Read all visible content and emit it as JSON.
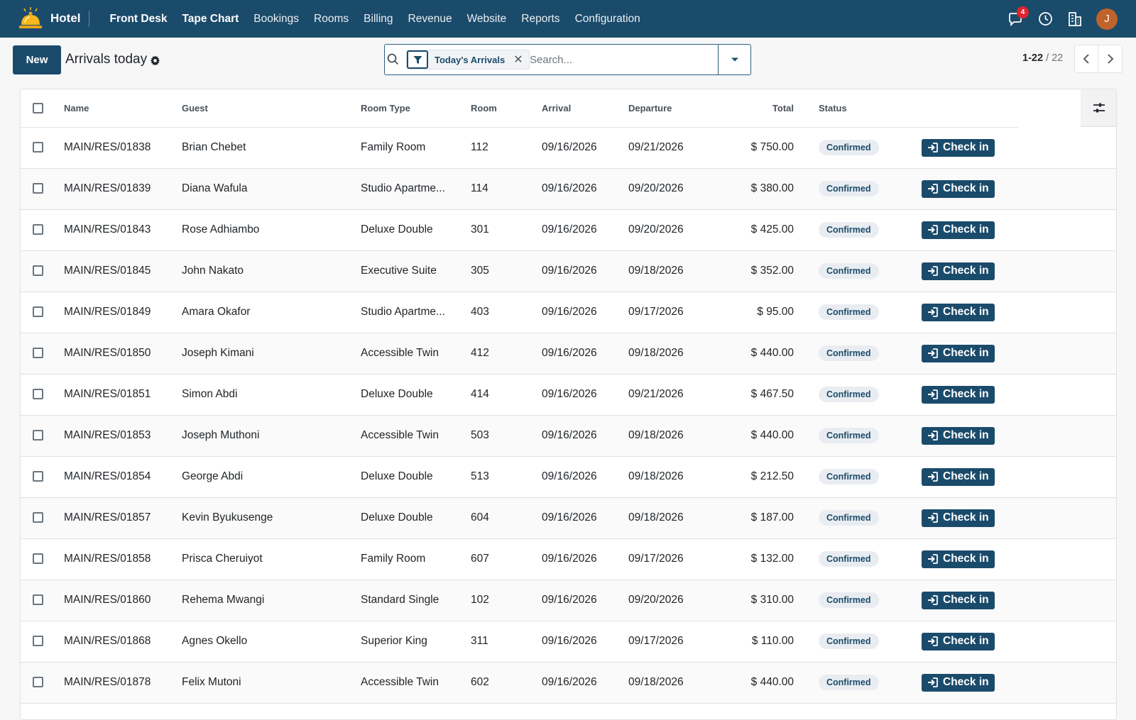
{
  "app": {
    "name": "Hotel"
  },
  "nav": {
    "items": [
      {
        "label": "Front Desk",
        "active": true
      },
      {
        "label": "Tape Chart",
        "active": true
      },
      {
        "label": "Bookings",
        "active": false
      },
      {
        "label": "Rooms",
        "active": false
      },
      {
        "label": "Billing",
        "active": false
      },
      {
        "label": "Revenue",
        "active": false
      },
      {
        "label": "Website",
        "active": false
      },
      {
        "label": "Reports",
        "active": false
      },
      {
        "label": "Configuration",
        "active": false
      }
    ],
    "messages_badge": "4",
    "avatar_initial": "J"
  },
  "control": {
    "new_label": "New",
    "title": "Arrivals today",
    "facet_label": "Today's Arrivals",
    "search_placeholder": "Search...",
    "pager_value": "1-22",
    "pager_limit": "/ 22"
  },
  "table": {
    "columns": [
      "Name",
      "Guest",
      "Room Type",
      "Room",
      "Arrival",
      "Departure",
      "Total",
      "Status"
    ],
    "checkin_label": "Check in",
    "rows": [
      {
        "name": "MAIN/RES/01838",
        "guest": "Brian Chebet",
        "room_type": "Family Room",
        "room": "112",
        "arrival": "09/16/2026",
        "departure": "09/21/2026",
        "total": "$ 750.00",
        "status": "Confirmed"
      },
      {
        "name": "MAIN/RES/01839",
        "guest": "Diana Wafula",
        "room_type": "Studio Apartme...",
        "room": "114",
        "arrival": "09/16/2026",
        "departure": "09/20/2026",
        "total": "$ 380.00",
        "status": "Confirmed"
      },
      {
        "name": "MAIN/RES/01843",
        "guest": "Rose Adhiambo",
        "room_type": "Deluxe Double",
        "room": "301",
        "arrival": "09/16/2026",
        "departure": "09/20/2026",
        "total": "$ 425.00",
        "status": "Confirmed"
      },
      {
        "name": "MAIN/RES/01845",
        "guest": "John Nakato",
        "room_type": "Executive Suite",
        "room": "305",
        "arrival": "09/16/2026",
        "departure": "09/18/2026",
        "total": "$ 352.00",
        "status": "Confirmed"
      },
      {
        "name": "MAIN/RES/01849",
        "guest": "Amara Okafor",
        "room_type": "Studio Apartme...",
        "room": "403",
        "arrival": "09/16/2026",
        "departure": "09/17/2026",
        "total": "$ 95.00",
        "status": "Confirmed"
      },
      {
        "name": "MAIN/RES/01850",
        "guest": "Joseph Kimani",
        "room_type": "Accessible Twin",
        "room": "412",
        "arrival": "09/16/2026",
        "departure": "09/18/2026",
        "total": "$ 440.00",
        "status": "Confirmed"
      },
      {
        "name": "MAIN/RES/01851",
        "guest": "Simon Abdi",
        "room_type": "Deluxe Double",
        "room": "414",
        "arrival": "09/16/2026",
        "departure": "09/21/2026",
        "total": "$ 467.50",
        "status": "Confirmed"
      },
      {
        "name": "MAIN/RES/01853",
        "guest": "Joseph Muthoni",
        "room_type": "Accessible Twin",
        "room": "503",
        "arrival": "09/16/2026",
        "departure": "09/18/2026",
        "total": "$ 440.00",
        "status": "Confirmed"
      },
      {
        "name": "MAIN/RES/01854",
        "guest": "George Abdi",
        "room_type": "Deluxe Double",
        "room": "513",
        "arrival": "09/16/2026",
        "departure": "09/18/2026",
        "total": "$ 212.50",
        "status": "Confirmed"
      },
      {
        "name": "MAIN/RES/01857",
        "guest": "Kevin Byukusenge",
        "room_type": "Deluxe Double",
        "room": "604",
        "arrival": "09/16/2026",
        "departure": "09/18/2026",
        "total": "$ 187.00",
        "status": "Confirmed"
      },
      {
        "name": "MAIN/RES/01858",
        "guest": "Prisca Cheruiyot",
        "room_type": "Family Room",
        "room": "607",
        "arrival": "09/16/2026",
        "departure": "09/17/2026",
        "total": "$ 132.00",
        "status": "Confirmed"
      },
      {
        "name": "MAIN/RES/01860",
        "guest": "Rehema Mwangi",
        "room_type": "Standard Single",
        "room": "102",
        "arrival": "09/16/2026",
        "departure": "09/20/2026",
        "total": "$ 310.00",
        "status": "Confirmed"
      },
      {
        "name": "MAIN/RES/01868",
        "guest": "Agnes Okello",
        "room_type": "Superior King",
        "room": "311",
        "arrival": "09/16/2026",
        "departure": "09/17/2026",
        "total": "$ 110.00",
        "status": "Confirmed"
      },
      {
        "name": "MAIN/RES/01878",
        "guest": "Felix Mutoni",
        "room_type": "Accessible Twin",
        "room": "602",
        "arrival": "09/16/2026",
        "departure": "09/18/2026",
        "total": "$ 440.00",
        "status": "Confirmed"
      }
    ]
  },
  "colors": {
    "brand": "#1b4b6b",
    "badge": "#e0242b",
    "avatar": "#c0632a"
  }
}
